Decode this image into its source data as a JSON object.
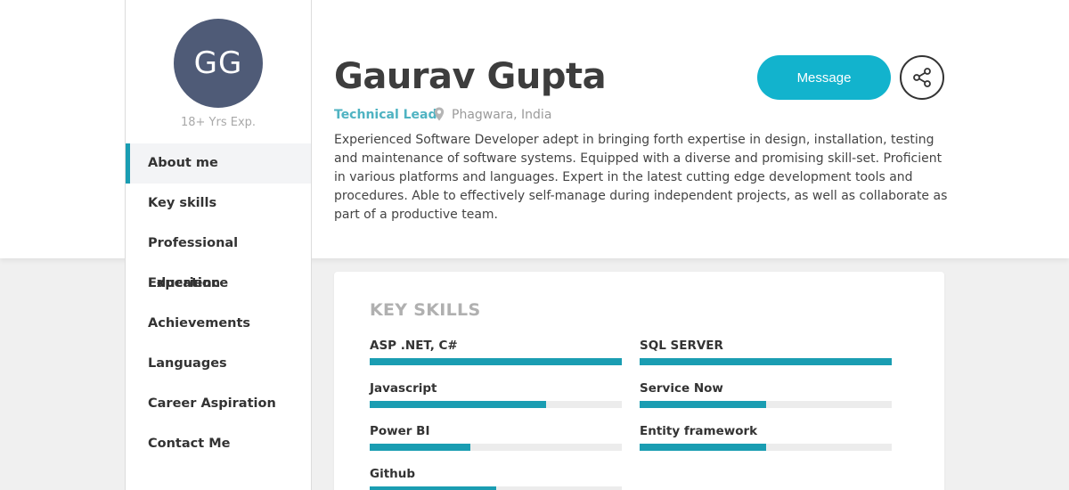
{
  "profile": {
    "initials": "GG",
    "experience": "18+ Yrs Exp.",
    "name": "Gaurav Gupta",
    "role": "Technical Lead",
    "location": "Phagwara, India",
    "about": "Experienced Software Developer adept in bringing forth expertise in design, installation, testing and maintenance of software systems. Equipped with a diverse and promising skill-set. Proficient in various platforms and languages. Expert in the latest cutting edge development tools and procedures. Able to effectively self-manage during independent projects, as well as collaborate as part of a productive team."
  },
  "actions": {
    "message_label": "Message",
    "share_icon": "share-icon"
  },
  "nav": {
    "items": [
      {
        "label": "About me",
        "active": true
      },
      {
        "label": "Key skills",
        "active": false
      },
      {
        "label": "Professional Experience",
        "active": false
      },
      {
        "label": "Education",
        "active": false
      },
      {
        "label": "Achievements",
        "active": false
      },
      {
        "label": "Languages",
        "active": false
      },
      {
        "label": "Career Aspiration",
        "active": false
      },
      {
        "label": "Contact Me",
        "active": false
      }
    ]
  },
  "skills": {
    "title": "KEY SKILLS",
    "items": [
      {
        "name": "ASP .NET, C#",
        "level": 1.0
      },
      {
        "name": "SQL SERVER",
        "level": 1.0
      },
      {
        "name": "Javascript",
        "level": 0.7
      },
      {
        "name": "Service Now",
        "level": 0.5
      },
      {
        "name": "Power BI",
        "level": 0.4
      },
      {
        "name": "Entity framework",
        "level": 0.5
      },
      {
        "name": "Github",
        "level": 0.5
      }
    ]
  },
  "colors": {
    "accent": "#1a9db2",
    "button": "#12b3cd",
    "avatar": "#4f5b77",
    "role": "#4fb3c2"
  }
}
